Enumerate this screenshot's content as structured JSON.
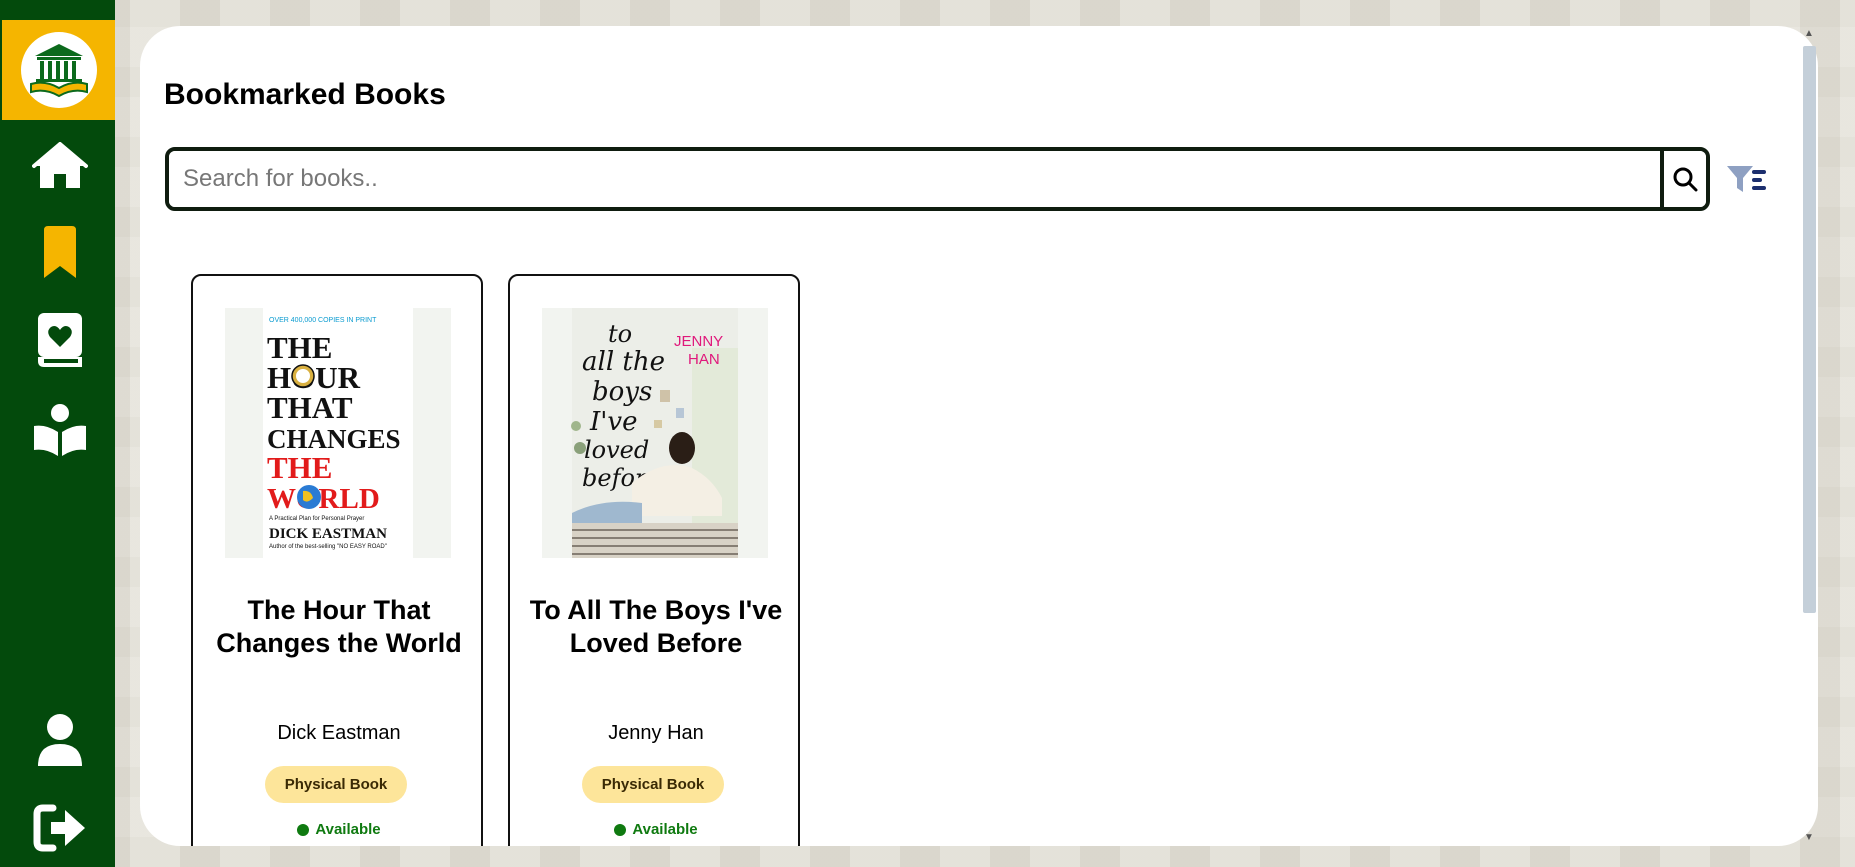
{
  "sidebar": {
    "logo_icon": "library-book-logo-icon",
    "items": [
      {
        "icon": "home-icon"
      },
      {
        "icon": "bookmark-icon"
      },
      {
        "icon": "favorite-book-icon"
      },
      {
        "icon": "reader-icon"
      },
      {
        "icon": "user-icon"
      },
      {
        "icon": "logout-icon"
      }
    ],
    "colors": {
      "background": "#034a0c",
      "accent": "#f5b500"
    }
  },
  "main": {
    "title": "Bookmarked Books",
    "search": {
      "placeholder": "Search for books..",
      "value": ""
    },
    "filter_icon": "filter-list-icon"
  },
  "books": [
    {
      "title": "The Hour That Changes the World",
      "author": "Dick Eastman",
      "format": "Physical Book",
      "status": "Available",
      "cover": {
        "top_note": "OVER 400,000 COPIES IN PRINT",
        "lines": [
          "THE",
          "HOUR",
          "THAT",
          "CHANGES"
        ],
        "red_lines": [
          "THE",
          "WORLD"
        ],
        "subtitle": "A Practical Plan for Personal Prayer",
        "author": "DICK EASTMAN",
        "footer": "Author of the best-selling \"NO EASY ROAD\""
      }
    },
    {
      "title": "To All The Boys I've Loved Before",
      "author": "Jenny Han",
      "format": "Physical Book",
      "status": "Available",
      "cover": {
        "script_lines": [
          "to",
          "all the",
          "boys",
          "I've",
          "loved",
          "before"
        ],
        "author_first": "JENNY",
        "author_last": "HAN"
      }
    }
  ]
}
